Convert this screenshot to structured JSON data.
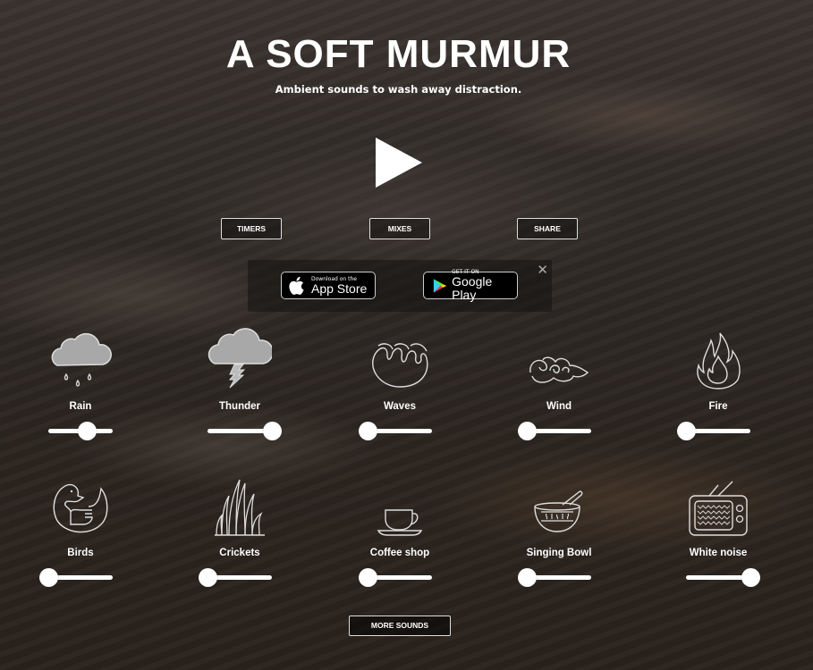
{
  "header": {
    "title": "A SOFT MURMUR",
    "subtitle": "Ambient sounds to wash away distraction."
  },
  "controls": {
    "play_icon": "play-icon",
    "timers_label": "TIMERS",
    "mixes_label": "MIXES",
    "share_label": "SHARE"
  },
  "app_banner": {
    "app_store_small": "Download on the",
    "app_store_big": "App Store",
    "google_play_small": "GET IT ON",
    "google_play_big": "Google Play",
    "close_label": "✕"
  },
  "sounds": [
    {
      "name": "Rain",
      "icon": "rain-cloud-icon",
      "volume": 0.6,
      "active": true
    },
    {
      "name": "Thunder",
      "icon": "thunder-cloud-icon",
      "volume": 1.0,
      "active": true
    },
    {
      "name": "Waves",
      "icon": "waves-icon",
      "volume": 0.0,
      "active": false
    },
    {
      "name": "Wind",
      "icon": "wind-icon",
      "volume": 0.0,
      "active": false
    },
    {
      "name": "Fire",
      "icon": "fire-icon",
      "volume": 0.0,
      "active": false
    },
    {
      "name": "Birds",
      "icon": "bird-icon",
      "volume": 0.0,
      "active": false
    },
    {
      "name": "Crickets",
      "icon": "grass-icon",
      "volume": 0.0,
      "active": false
    },
    {
      "name": "Coffee shop",
      "icon": "coffee-cup-icon",
      "volume": 0.0,
      "active": false
    },
    {
      "name": "Singing Bowl",
      "icon": "singing-bowl-icon",
      "volume": 0.0,
      "active": false
    },
    {
      "name": "White noise",
      "icon": "tv-icon",
      "volume": 1.0,
      "active": false
    }
  ],
  "more_sounds_label": "MORE SOUNDS",
  "colors": {
    "text": "#ffffff",
    "icon_stroke": "#d8d8d8",
    "active_icon_fill": "#a8a8a8",
    "background": "#2e2925"
  }
}
